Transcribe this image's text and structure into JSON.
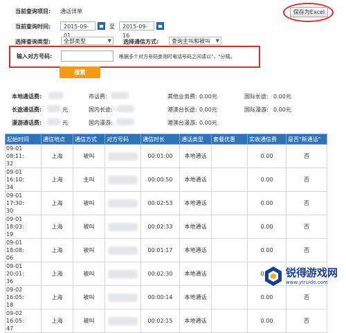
{
  "query": {
    "project_label": "当前查询项目:",
    "project_value": "通话详单",
    "time_label": "当前查询时间:",
    "date_from": "2015-09-01",
    "date_sep": "至",
    "date_to": "2015-09-16",
    "type_label": "选择查询类型:",
    "type_value": "全部类型",
    "mode_label": "选择通信方式:",
    "mode_value": "查询主叫和被叫",
    "phone_label": "输入对方号码:",
    "phone_value": "",
    "phone_hint": "根据多个对方号码查询时电话号码之间请以\"，\"分隔。",
    "search_label": "搜索",
    "save_label": "保存为Excel"
  },
  "summary": {
    "local_fee_label": "本地通话费:",
    "city_fee_label": "市话费:",
    "other_fee_label": "其他业务费:",
    "other_fee_value": "0.00元",
    "intl_ld_label": "国际长途:",
    "intl_ld_value": "0.00元",
    "ld_fee_label": "长途通话费:",
    "ld_fee_unit": "元",
    "domestic_ld_label": "国内长途:",
    "hk_ld_label": "港澳台长途:",
    "hk_ld_value": "0.00元",
    "intl_roam_label": "国际漫游:",
    "intl_roam_value": "0.00元",
    "roam_fee_label": "漫游通话费:",
    "roam_fee_unit": "元",
    "domestic_roam_label": "国内漫游:",
    "hk_roam_label": "港澳台漫游:",
    "hk_roam_value": "0.00元"
  },
  "table": {
    "headers": [
      "起始时间",
      "通信地点",
      "通信方式",
      "对方号码",
      "通信时长",
      "通话类型",
      "套餐优惠",
      "实收通信费",
      "是否\"新通话\""
    ],
    "rows": [
      {
        "time1": "09-01 08:11:",
        "time2": "32",
        "place": "上海",
        "mode": "被叫",
        "duration": "00:01:00",
        "type": "本地通话",
        "fee": "0.00",
        "new": "否"
      },
      {
        "time1": "09-01 16:10:",
        "time2": "34",
        "place": "上海",
        "mode": "主叫",
        "duration": "00:00:50",
        "type": "本地通话",
        "fee": "0.00",
        "new": "否"
      },
      {
        "time1": "09-01 17:30:",
        "time2": "30",
        "place": "上海",
        "mode": "被叫",
        "duration": "00:02:53",
        "type": "本地通话",
        "fee": "0.00",
        "new": "否"
      },
      {
        "time1": "09-01 18:03:",
        "time2": "19",
        "place": "上海",
        "mode": "被叫",
        "duration": "00:02:33",
        "type": "本地通话",
        "fee": "0.00",
        "new": "否"
      },
      {
        "time1": "09-01 18:08:",
        "time2": "06",
        "place": "上海",
        "mode": "被叫",
        "duration": "00:01:17",
        "type": "本地通话",
        "fee": "0.00",
        "new": "否"
      },
      {
        "time1": "09-01 20:01:",
        "time2": "36",
        "place": "上海",
        "mode": "被叫",
        "duration": "00:02:30",
        "type": "本地通话",
        "fee": "0.00",
        "new": "否"
      },
      {
        "time1": "09-02 16:05:",
        "time2": "18",
        "place": "上海",
        "mode": "被叫",
        "duration": "00:00:14",
        "type": "本地通话",
        "fee": "0.00",
        "new": "否"
      },
      {
        "time1": "09-02 16:05:",
        "time2": "47",
        "place": "上海",
        "mode": "被叫",
        "duration": "00:02:15",
        "type": "本地通话",
        "fee": "0.00",
        "new": "否"
      }
    ]
  },
  "watermark": {
    "title": "锐得游戏网",
    "url": "www.ytruido.com"
  },
  "colors": {
    "header_blue": "#2d73b8",
    "search_orange": "#f49a13",
    "highlight_red": "#d92b2b"
  }
}
